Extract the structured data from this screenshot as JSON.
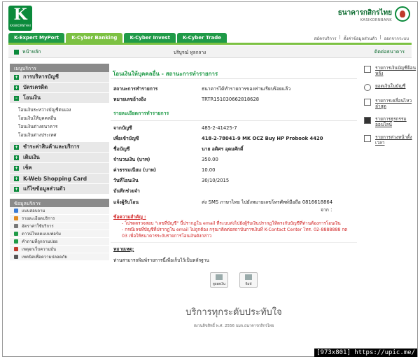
{
  "header": {
    "logo_mark": "K",
    "logo_text": "KASIKORNTHAI",
    "bank_name_th": "ธนาคารกสิกรไทย",
    "bank_name_en": "KASIKORNBANK",
    "tabs": [
      {
        "label": "K-Expert MyPort"
      },
      {
        "label": "K-Cyber Banking"
      },
      {
        "label": "K-Cyber Invest"
      },
      {
        "label": "K-Cyber Trade"
      }
    ],
    "top_links": [
      "สมัครบริการ",
      "|",
      "ตั้งค่าข้อมูลส่วนตัว",
      "|",
      "ออกจากระบบ"
    ]
  },
  "crumb": {
    "home": "หน้าหลัก",
    "company": "บริบูรณ์ ทูลกลาง",
    "contact": "ติดต่อธนาคาร"
  },
  "left_menu": {
    "title": "เมนูบริการ",
    "items": [
      {
        "label": "การบริหารบัญชี"
      },
      {
        "label": "บัตรเครดิต"
      },
      {
        "label": "โอนเงิน"
      }
    ],
    "sub_items": [
      "โอนเงินระหว่างบัญชีตนเอง",
      "โอนเงินให้บุคคลอื่น",
      "โอนเงินต่างธนาคาร",
      "โอนเงินต่างประเทศ"
    ],
    "items2": [
      {
        "label": "ชำระค่าสินค้าและบริการ"
      },
      {
        "label": "เติมเงิน"
      },
      {
        "label": "เช็ค"
      },
      {
        "label": "K-Web Shopping Card"
      },
      {
        "label": "แก้ไขข้อมูลส่วนตัว"
      }
    ],
    "service_title": "ข้อมูลบริการ",
    "service_items": [
      "แบบสอบถาม",
      "รายละเอียดบริการ",
      "อัตราค่าใช้บริการ",
      "ดาวน์โหลดแบบฟอร์ม",
      "คำถามที่ถูกถามบ่อย",
      "เหตุผกเว็บความมั่น",
      "เทคนิคเพื่อความปลอดภัย"
    ]
  },
  "main": {
    "title": "โอนเงินให้บุคคลอื่น - สถานะการทำรายการ",
    "status_label": "สถานะการทำรายการ",
    "status_value": "ธนาคารได้ทำรายการของท่านเรียบร้อยแล้ว",
    "ref_label": "หมายเลขอ้างอิง",
    "ref_value": "TRTR151030662818628",
    "section_title": "รายละเอียดการทำรายการ",
    "from_label": "จากบัญชี",
    "from_value": "485-2-41425-7",
    "to_label": "เพื่อเข้าบัญชี",
    "to_value": "418-2-78041-9 MK OCZ Buy HP Probook 4420",
    "name_label": "ชื่อบัญชี",
    "name_value": "นาย อดิศร อุดมศักดิ์",
    "amount_label": "จำนวนเงิน (บาท)",
    "amount_value": "350.00",
    "fee_label": "ค่าธรรมเนียม (บาท)",
    "fee_value": "10.00",
    "date_label": "วันที่โอนเงิน",
    "date_value": "30/10/2015",
    "memo_label": "บันทึกช่วยจำ",
    "memo_value": "",
    "notify_label": "แจ้งผู้รับโอน",
    "notify_value": "ส่ง SMS ภาษาไทย ไปยังหมายเลขโทรศัพท์มือถือ 0816618864",
    "notify_from": "จาก :",
    "note_head": "ข้อความสำคัญ :",
    "note_1": "- โปรดตรวจสอบ \"เลขที่บัญชี\" นี้ปรากฏใน email ที่ระบบส่งไปยังผู้รับเงินปรากฏให้ตรงกับบัญชีที่ท่านต้องการโอนเงิน",
    "note_2": "- กรณีเลขที่บัญชีที่ปรากฏใน email ไม่ถูกต้อง กรุณาติดต่อสถาบันการเงินที่ K-Contact Center โทร. 02-8888888 กด 03 เพื่อให้ธนาคารระงับรายการโอนเงินดังกล่าว",
    "remark_head": "หมายเหตุ:",
    "remark_text": "ท่านสามารถพิมพ์รายการนี้เพื่อเก็บไว้เป็นหลักฐาน",
    "btn_save": "ดูยอดเงิน",
    "btn_print": "พิมพ์",
    "slogan": "บริการทุกระดับประทับใจ",
    "copyright": "สงวนลิขสิทธิ์ พ.ศ. 2556 บมจ.ธนาคารกสิกรไทย"
  },
  "right_rail": [
    {
      "label": "รายการเงินบัญชีย้อนหลัง"
    },
    {
      "label": "ยอดเงินในบัญชี"
    },
    {
      "label": "รายการเคลื่อนไหวล่าสุด"
    },
    {
      "label": "รายการธุรกรรมออนไลน์"
    },
    {
      "label": "รายการล่วงหน้าตั้งเวลา"
    }
  ],
  "watermark": "[973x801] https://upic.me/"
}
